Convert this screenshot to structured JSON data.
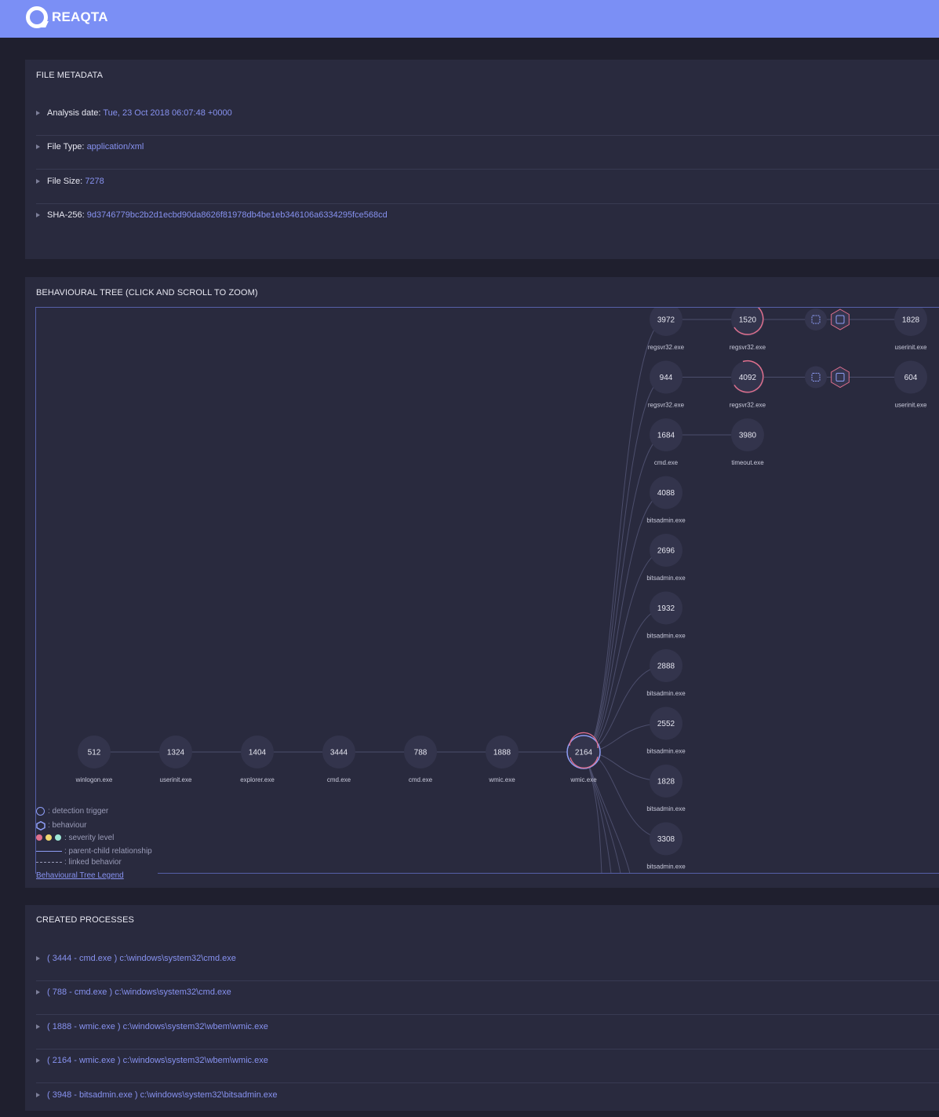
{
  "header": {
    "brand": "REAQTA"
  },
  "file_metadata": {
    "title": "FILE METADATA",
    "rows": [
      {
        "label": "Analysis date:",
        "value": "Tue, 23 Oct 2018 06:07:48 +0000"
      },
      {
        "label": "File Type:",
        "value": "application/xml"
      },
      {
        "label": "File Size:",
        "value": "7278"
      },
      {
        "label": "SHA-256:",
        "value": "9d3746779bc2b2d1ecbd90da8626f81978db4be1eb346106a6334295fce568cd"
      }
    ]
  },
  "behavioural_tree": {
    "title": "BEHAVIOURAL TREE (CLICK AND SCROLL TO ZOOM)",
    "chain": [
      {
        "pid": "512",
        "name": "winlogon.exe"
      },
      {
        "pid": "1324",
        "name": "userinit.exe"
      },
      {
        "pid": "1404",
        "name": "explorer.exe"
      },
      {
        "pid": "3444",
        "name": "cmd.exe"
      },
      {
        "pid": "788",
        "name": "cmd.exe"
      },
      {
        "pid": "1888",
        "name": "wmic.exe"
      },
      {
        "pid": "2164",
        "name": "wmic.exe",
        "trigger": true
      }
    ],
    "children": [
      {
        "pid": "3972",
        "name": "regsvr32.exe"
      },
      {
        "pid": "944",
        "name": "regsvr32.exe"
      },
      {
        "pid": "1684",
        "name": "cmd.exe"
      },
      {
        "pid": "4088",
        "name": "bitsadmin.exe"
      },
      {
        "pid": "2696",
        "name": "bitsadmin.exe"
      },
      {
        "pid": "1932",
        "name": "bitsadmin.exe"
      },
      {
        "pid": "2888",
        "name": "bitsadmin.exe"
      },
      {
        "pid": "2552",
        "name": "bitsadmin.exe"
      },
      {
        "pid": "1828",
        "name": "bitsadmin.exe"
      },
      {
        "pid": "3308",
        "name": "bitsadmin.exe"
      }
    ],
    "grandchildren": [
      {
        "pid": "1520",
        "name": "regsvr32.exe",
        "severity": true,
        "end": {
          "pid": "1828",
          "name": "userinit.exe"
        }
      },
      {
        "pid": "4092",
        "name": "regsvr32.exe",
        "severity": true,
        "end": {
          "pid": "604",
          "name": "userinit.exe"
        }
      },
      {
        "pid": "3980",
        "name": "timeout.exe"
      }
    ],
    "legend": {
      "detection_trigger": ": detection trigger",
      "behaviour": ": behaviour",
      "severity": ": severity level",
      "parent_child": ": parent-child relationship",
      "linked": ": linked behavior",
      "link": "Behavioural Tree Legend"
    },
    "colors": {
      "accent": "#8e9df5",
      "severity_high": "#e0708e",
      "severity_mid": "#f0d770",
      "severity_low": "#9ee8d6"
    }
  },
  "created_processes": {
    "title": "CREATED PROCESSES",
    "rows": [
      {
        "id": "( 3444 - cmd.exe )",
        "path": "c:\\windows\\system32\\cmd.exe"
      },
      {
        "id": "( 788 - cmd.exe )",
        "path": "c:\\windows\\system32\\cmd.exe"
      },
      {
        "id": "( 1888 - wmic.exe )",
        "path": "c:\\windows\\system32\\wbem\\wmic.exe"
      },
      {
        "id": "( 2164 - wmic.exe )",
        "path": "c:\\windows\\system32\\wbem\\wmic.exe"
      },
      {
        "id": "( 3948 - bitsadmin.exe )",
        "path": "c:\\windows\\system32\\bitsadmin.exe"
      }
    ]
  }
}
